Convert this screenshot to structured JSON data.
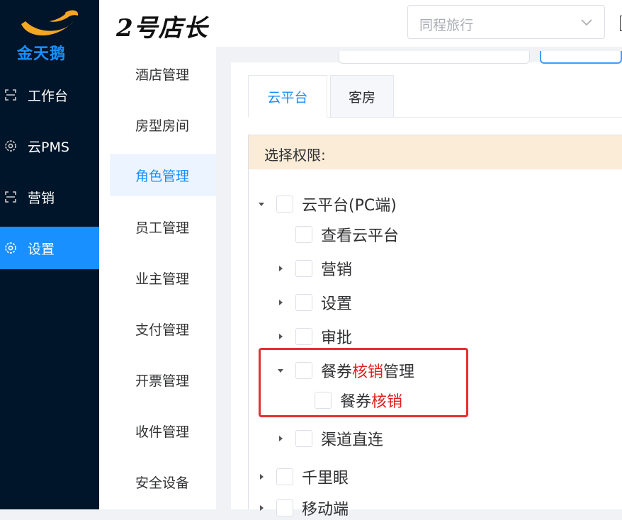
{
  "app": {
    "logo_text": "金天鹅",
    "brand_title": "2号店长",
    "hotel_select": {
      "value": "同程旅行"
    }
  },
  "sidebar": {
    "items": [
      {
        "label": "工作台",
        "icon": "workbench-icon",
        "active": false
      },
      {
        "label": "云PMS",
        "icon": "gear-icon",
        "active": false
      },
      {
        "label": "营销",
        "icon": "marketing-icon",
        "active": false
      },
      {
        "label": "设置",
        "icon": "gear-icon",
        "active": true
      }
    ]
  },
  "submenu": {
    "items": [
      {
        "label": "酒店管理",
        "active": false
      },
      {
        "label": "房型房间",
        "active": false
      },
      {
        "label": "角色管理",
        "active": true
      },
      {
        "label": "员工管理",
        "active": false
      },
      {
        "label": "业主管理",
        "active": false
      },
      {
        "label": "支付管理",
        "active": false
      },
      {
        "label": "开票管理",
        "active": false
      },
      {
        "label": "收件管理",
        "active": false
      },
      {
        "label": "安全设备",
        "active": false
      }
    ]
  },
  "tabs": [
    {
      "label": "云平台",
      "active": true
    },
    {
      "label": "客房",
      "active": false
    }
  ],
  "permissions": {
    "header": "选择权限:",
    "tree": [
      {
        "label": "云平台(PC端)",
        "caret": "expanded"
      },
      {
        "label": "查看云平台",
        "caret": "none"
      },
      {
        "label": "营销",
        "caret": "collapsed"
      },
      {
        "label": "设置",
        "caret": "collapsed"
      },
      {
        "label": "审批",
        "caret": "collapsed"
      },
      {
        "label_parts": [
          "餐券",
          "核销",
          "管理"
        ],
        "caret": "expanded"
      },
      {
        "label_parts": [
          "餐券",
          "核销"
        ],
        "caret": "none"
      },
      {
        "label": "渠道直连",
        "caret": "collapsed"
      },
      {
        "label": "千里眼",
        "caret": "collapsed"
      },
      {
        "label": "移动端",
        "caret": "collapsed"
      }
    ]
  },
  "colors": {
    "sidebar_bg": "#001529",
    "accent": "#1890ff",
    "highlight_red": "#e53030",
    "perm_header_bg": "#fbecd8"
  }
}
